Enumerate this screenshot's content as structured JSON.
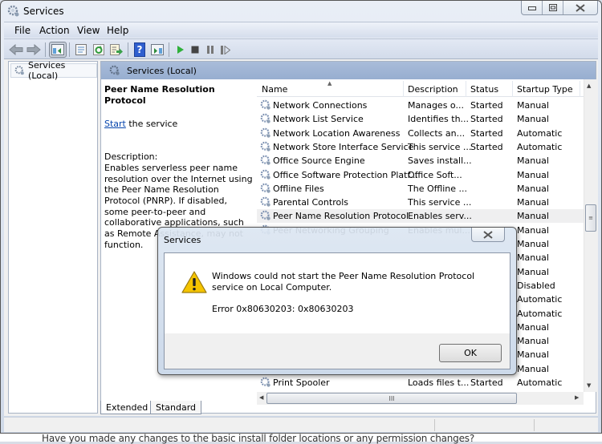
{
  "window": {
    "title": "Services",
    "caption_buttons": {
      "minimize": "minimize",
      "maximize": "maximize",
      "close": "close"
    }
  },
  "menu": [
    "File",
    "Action",
    "View",
    "Help"
  ],
  "toolbar": [
    {
      "name": "back-icon"
    },
    {
      "name": "forward-icon"
    },
    {
      "name": "show-hide-console-tree-icon"
    },
    {
      "name": "properties-icon"
    },
    {
      "name": "refresh-icon"
    },
    {
      "name": "export-list-icon"
    },
    {
      "name": "help-icon"
    },
    {
      "name": "show-action-pane-icon"
    },
    {
      "name": "start-service-icon"
    },
    {
      "name": "stop-service-icon"
    },
    {
      "name": "pause-service-icon"
    },
    {
      "name": "restart-service-icon"
    }
  ],
  "tree": {
    "item": "Services (Local)"
  },
  "panel": {
    "header": "Services (Local)",
    "selected_service": "Peer Name Resolution Protocol",
    "start_link": "Start",
    "start_suffix": " the service",
    "description_label": "Description:",
    "description": "Enables serverless peer name resolution over the Internet using the Peer Name Resolution Protocol (PNRP). If disabled, some peer-to-peer and collaborative applications, such as Remote Assistance, may not function."
  },
  "table": {
    "columns": [
      "Name",
      "Description",
      "Status",
      "Startup Type"
    ],
    "rows": [
      {
        "name": "Network Connections",
        "description": "Manages o...",
        "status": "Started",
        "startup": "Manual"
      },
      {
        "name": "Network List Service",
        "description": "Identifies th...",
        "status": "Started",
        "startup": "Manual"
      },
      {
        "name": "Network Location Awareness",
        "description": "Collects an...",
        "status": "Started",
        "startup": "Automatic"
      },
      {
        "name": "Network Store Interface Service",
        "description": "This service ...",
        "status": "Started",
        "startup": "Automatic"
      },
      {
        "name": "Office  Source Engine",
        "description": "Saves install...",
        "status": "",
        "startup": "Manual"
      },
      {
        "name": "Office Software Protection Platf...",
        "description": "Office Soft...",
        "status": "",
        "startup": "Manual"
      },
      {
        "name": "Offline Files",
        "description": "The Offline ...",
        "status": "",
        "startup": "Manual"
      },
      {
        "name": "Parental Controls",
        "description": "This service ...",
        "status": "",
        "startup": "Manual"
      },
      {
        "name": "Peer Name Resolution Protocol",
        "description": "Enables serv...",
        "status": "",
        "startup": "Manual",
        "selected": true
      },
      {
        "name": "Peer Networking Grouping",
        "description": "Enables mul...",
        "status": "",
        "startup": "Manual"
      },
      {
        "name": "",
        "description": "",
        "status": "",
        "startup": "Manual"
      },
      {
        "name": "",
        "description": "",
        "status": "",
        "startup": "Manual"
      },
      {
        "name": "",
        "description": "",
        "status": "",
        "startup": "Manual"
      },
      {
        "name": "",
        "description": "",
        "status": "",
        "startup": "Disabled"
      },
      {
        "name": "",
        "description": "",
        "status": "",
        "startup": "Automatic"
      },
      {
        "name": "",
        "description": "",
        "status": "",
        "startup": "Automatic"
      },
      {
        "name": "",
        "description": "",
        "status": "",
        "startup": "Manual"
      },
      {
        "name": "",
        "description": "",
        "status": "",
        "startup": "Manual"
      },
      {
        "name": "",
        "description": "",
        "status": "",
        "startup": "Manual"
      },
      {
        "name": "",
        "description": "",
        "status": "",
        "startup": "Manual"
      },
      {
        "name": "Print Spooler",
        "description": "Loads files t...",
        "status": "Started",
        "startup": "Automatic"
      }
    ]
  },
  "tabs": [
    "Extended",
    "Standard"
  ],
  "dialog": {
    "title": "Services",
    "message": "Windows could not start the Peer Name Resolution Protocol service on Local Computer.",
    "error": "Error 0x80630203: 0x80630203",
    "ok_label": "OK"
  },
  "background_text": "Have you made any changes to the basic install folder locations or any permission changes?"
}
